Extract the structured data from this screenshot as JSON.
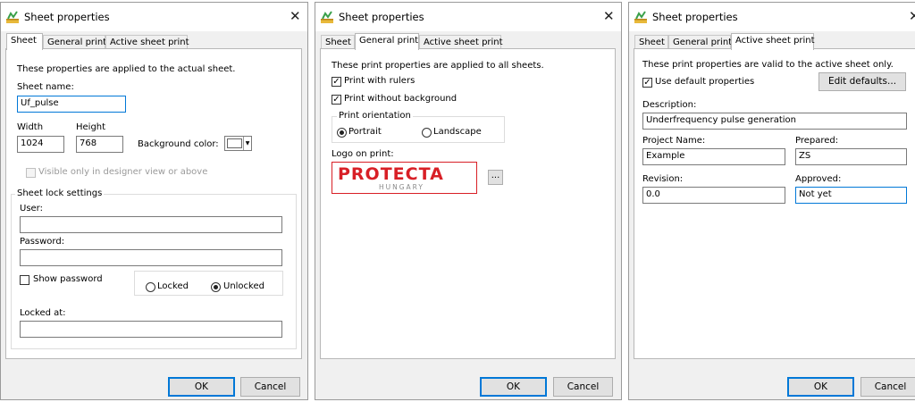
{
  "dialogs": [
    {
      "title": "Sheet properties",
      "tabs": [
        "Sheet",
        "General print",
        "Active sheet print"
      ],
      "intro": "These properties are applied to the actual sheet.",
      "sheet_name_label": "Sheet name:",
      "sheet_name_value": "Uf_pulse",
      "width_label": "Width",
      "width_value": "1024",
      "height_label": "Height",
      "height_value": "768",
      "bg_color_label": "Background color:",
      "visible_only_label": "Visible only in designer view or above",
      "lock_group_title": "Sheet lock settings",
      "user_label": "User:",
      "user_value": "",
      "password_label": "Password:",
      "password_value": "",
      "show_password_label": "Show password",
      "locked_label": "Locked",
      "unlocked_label": "Unlocked",
      "locked_at_label": "Locked at:",
      "locked_at_value": "",
      "ok": "OK",
      "cancel": "Cancel"
    },
    {
      "title": "Sheet properties",
      "tabs": [
        "Sheet",
        "General print",
        "Active sheet print"
      ],
      "intro": "These print properties are applied to all sheets.",
      "rulers_label": "Print with rulers",
      "rulers_checked": true,
      "no_bg_label": "Print without background",
      "no_bg_checked": true,
      "orientation_title": "Print orientation",
      "portrait_label": "Portrait",
      "landscape_label": "Landscape",
      "orientation_selected": "Portrait",
      "logo_label": "Logo on print:",
      "logo_main": "PROTECTA",
      "logo_sub": "HUNGARY",
      "browse_label": "...",
      "ok": "OK",
      "cancel": "Cancel"
    },
    {
      "title": "Sheet properties",
      "tabs": [
        "Sheet",
        "General print",
        "Active sheet print"
      ],
      "intro": "These print properties are valid to the active sheet only.",
      "use_default_label": "Use default properties",
      "use_default_checked": true,
      "edit_defaults_label": "Edit defaults...",
      "description_label": "Description:",
      "description_value": "Underfrequency pulse generation",
      "project_label": "Project Name:",
      "project_value": "Example",
      "prepared_label": "Prepared:",
      "prepared_value": "ZS",
      "revision_label": "Revision:",
      "revision_value": "0.0",
      "approved_label": "Approved:",
      "approved_value": "Not yet",
      "ok": "OK",
      "cancel": "Cancel"
    }
  ],
  "icons": {
    "app": "sheet-properties-icon",
    "close": "close-icon",
    "dropdown": "chevron-down-icon"
  },
  "colors": {
    "focus": "#0078d7",
    "logo_red": "#d81f26",
    "logo_gray": "#8a8a8a"
  }
}
